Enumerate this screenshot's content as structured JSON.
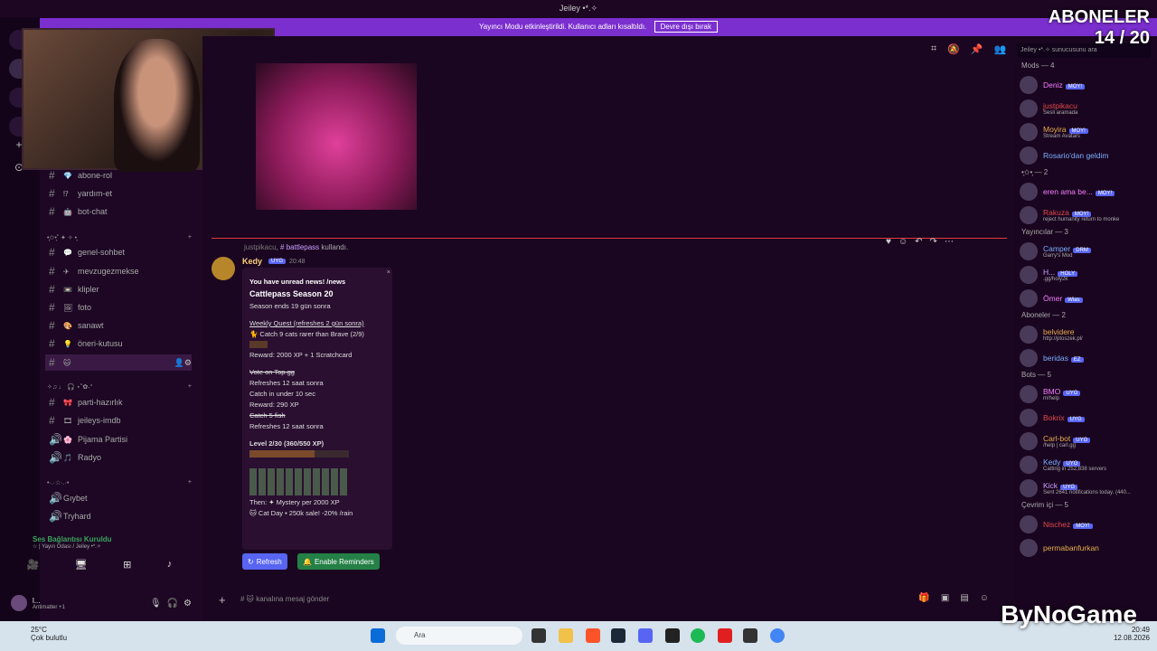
{
  "window": {
    "title": "Jeiley •*.✧"
  },
  "notice": {
    "text": "Yayıncı Modu etkinleştirildi. Kullanıcı adları kısaltıldı.",
    "button": "Devre dışı bırak"
  },
  "subs": {
    "label": "ABONELER",
    "count": "14 / 20"
  },
  "channels": [
    {
      "name": "abone-rol",
      "emoji": "💎"
    },
    {
      "name": "yardım-et",
      "emoji": "⁉"
    },
    {
      "name": "bot-chat",
      "emoji": "🤖"
    },
    {
      "name": "genel-sohbet",
      "emoji": "💬"
    },
    {
      "name": "mevzugezmekse",
      "emoji": "✈"
    },
    {
      "name": "klipler",
      "emoji": "📼"
    },
    {
      "name": "foto",
      "emoji": "🖼"
    },
    {
      "name": "sanawt",
      "emoji": "🎨"
    },
    {
      "name": "öneri-kutusu",
      "emoji": "💡"
    },
    {
      "name": "",
      "emoji": "🐱"
    },
    {
      "name": "parti-hazırlık",
      "emoji": "🎀"
    },
    {
      "name": "jeileys-imdb",
      "emoji": "🎞"
    },
    {
      "name": "Pijama Partisi",
      "emoji": "🌸"
    },
    {
      "name": "Radyo",
      "emoji": "🎵"
    },
    {
      "name": "Gıybet",
      "emoji": ""
    },
    {
      "name": "Tryhard",
      "emoji": ""
    }
  ],
  "categories": [
    "•̩͙✩•̩͙˚ ✦ ✧ •̩͙",
    "✧♫ ♩ 🎧 ⋆˚✿˖°",
    "•·.·☆·.·•"
  ],
  "voice": {
    "status": "Ses Bağlantısı Kuruldu",
    "channel": "☆ | Yayın Odası / Jeiley •*.✧"
  },
  "user": {
    "name": "l...",
    "status": "Antimatter +1"
  },
  "message": {
    "reply_user": "justpikacu",
    "reply_cmd": "# battlepass",
    "reply_tail": "kullandı.",
    "author": "Kedy",
    "tag": "UYG",
    "time": "20:48"
  },
  "embed": {
    "news": "You have unread news! /news",
    "title": "Cattlepass Season 20",
    "season": "Season ends 19 gün sonra",
    "weekly": "Weekly Quest (refreshes 2 gün sonra)",
    "catch": "🐈 Catch 9 cats rarer than Brave (2/9)",
    "reward1": "Reward: 2000 XP + 1 Scratchcard",
    "vote": "Vote on Top.gg",
    "refresh1": "Refreshes 12 saat sonra",
    "catchtime": "Catch in under 10 sec",
    "reward2": "Reward: 290 XP",
    "fish": "Catch 5 fish",
    "refresh2": "Refreshes 12 saat sonra",
    "level": "Level 2/30 (360/550 XP)",
    "then": "Then: ✦ Mystery per 2000 XP",
    "sale": "🐱 Cat Day • 250k sale! -20% /rain",
    "refresh_btn": "Refresh",
    "remind_btn": "Enable Reminders",
    "level_progress": 0.65
  },
  "composer": {
    "placeholder": "# 🐱 kanalına mesaj gönder"
  },
  "members_search": "Jeiley •*.✧ sunucusunu ara",
  "members": [
    {
      "cat": "Mods — 4"
    },
    {
      "name": "Deniz",
      "tag": "MOY!",
      "status": ""
    },
    {
      "name": "justpikacu",
      "tag": "",
      "status": "Sesli aramada"
    },
    {
      "name": "Moyira",
      "tag": "MOY!",
      "status": "Stream Avatars"
    },
    {
      "name": "Rosario'dan geldim",
      "tag": "",
      "status": ""
    },
    {
      "cat": "•̩͙✩•̩͙ — 2"
    },
    {
      "name": "eren ama be...",
      "tag": "MOY!",
      "status": ""
    },
    {
      "name": "Rakuza",
      "tag": "MOY!",
      "status": "reject humanity return to monke"
    },
    {
      "cat": "Yayıncılar — 3"
    },
    {
      "name": "Camper",
      "tag": "DRM",
      "status": "Garry's Mod"
    },
    {
      "name": "H...",
      "tag": "HOLY",
      "status": ".gg/holy2k"
    },
    {
      "name": "Ömer",
      "tag": "Wias",
      "status": ""
    },
    {
      "cat": "Aboneler — 2"
    },
    {
      "name": "belvidere",
      "tag": "",
      "status": "http://ptoszek.pl/"
    },
    {
      "name": "beridas",
      "tag": "EZ",
      "status": ""
    },
    {
      "cat": "Bots — 5"
    },
    {
      "name": "BMO",
      "tag": "UYG",
      "status": "m!help"
    },
    {
      "name": "Bokrix",
      "tag": "UYG",
      "status": ""
    },
    {
      "name": "Carl-bot",
      "tag": "UYG",
      "status": "/help | carl.gg"
    },
    {
      "name": "Kedy",
      "tag": "UYG",
      "status": "Catting in 252,838 servers"
    },
    {
      "name": "Kick",
      "tag": "UYG",
      "status": "Sent 2641 notifications today. (440..."
    },
    {
      "cat": "Çevrim içi — 5"
    },
    {
      "name": "Nischez",
      "tag": "MOY!",
      "status": ""
    },
    {
      "name": "permabanfurkan",
      "tag": "",
      "status": ""
    }
  ],
  "weather": {
    "temp": "25°C",
    "desc": "Çok bulutlu"
  },
  "search": {
    "placeholder": "Ara"
  },
  "clock": {
    "time": "20:49",
    "date": "12.08.2026"
  },
  "watermark": "ByNoGame"
}
